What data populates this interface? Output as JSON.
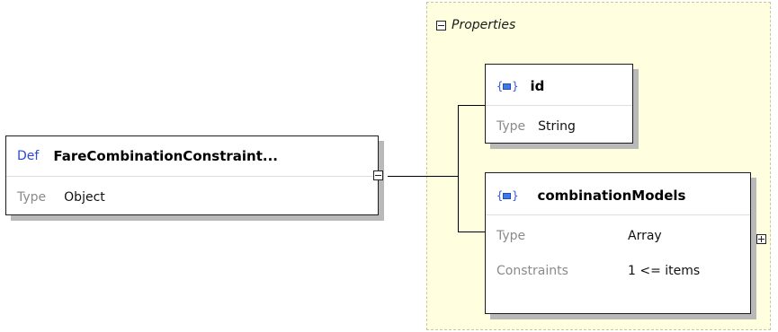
{
  "root": {
    "kind_label": "Def",
    "name": "FareCombinationConstraint...",
    "type_label": "Type",
    "type_value": "Object"
  },
  "properties_group": {
    "title": "Properties"
  },
  "properties": [
    {
      "name": "id",
      "type_label": "Type",
      "type_value": "String"
    },
    {
      "name": "combinationModels",
      "type_label": "Type",
      "type_value": "Array",
      "constraints_label": "Constraints",
      "constraints_value": "1 <= items"
    }
  ],
  "colors": {
    "group_background": "#ffffe0",
    "def_label": "#2a49d8",
    "object_icon": "#3d7bea"
  },
  "icons": {
    "collapse": "minus-box-icon",
    "expand": "plus-box-icon",
    "object": "object-braces-icon"
  }
}
